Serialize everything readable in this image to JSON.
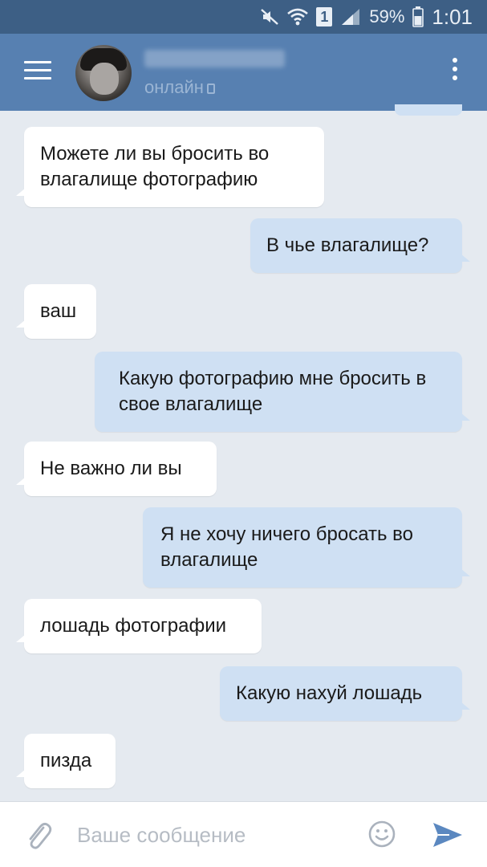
{
  "status_bar": {
    "sim_label": "1",
    "battery": "59%",
    "time": "1:01",
    "icons": [
      "mute-icon",
      "wifi-icon",
      "signal-icon",
      "battery-icon"
    ]
  },
  "header": {
    "contact_status": "онлайн",
    "icons": [
      "menu-icon",
      "more-icon"
    ]
  },
  "messages": [
    {
      "side": "in",
      "text": "Можете ли вы бросить во влагалище фотографию"
    },
    {
      "side": "out",
      "text": "В чье влагалище?"
    },
    {
      "side": "in",
      "text": "ваш"
    },
    {
      "side": "out",
      "text": "Какую фотографию мне бросить в свое влагалище"
    },
    {
      "side": "in",
      "text": "Не важно ли вы"
    },
    {
      "side": "out",
      "text": "Я не хочу ничего бросать во влагалище"
    },
    {
      "side": "in",
      "text": "лошадь фотографии"
    },
    {
      "side": "out",
      "text": "Какую нахуй лошадь"
    },
    {
      "side": "in",
      "text": "пизда"
    }
  ],
  "composer": {
    "placeholder": "Ваше сообщение",
    "value": "",
    "icons": [
      "paperclip-icon",
      "emoji-icon",
      "send-icon"
    ]
  },
  "colors": {
    "status_bar": "#3d5f85",
    "header": "#5780b1",
    "chat_background": "#e5eaf0",
    "incoming_bubble": "#ffffff",
    "outgoing_bubble": "#cfe0f3",
    "send_accent": "#5b88c0"
  }
}
